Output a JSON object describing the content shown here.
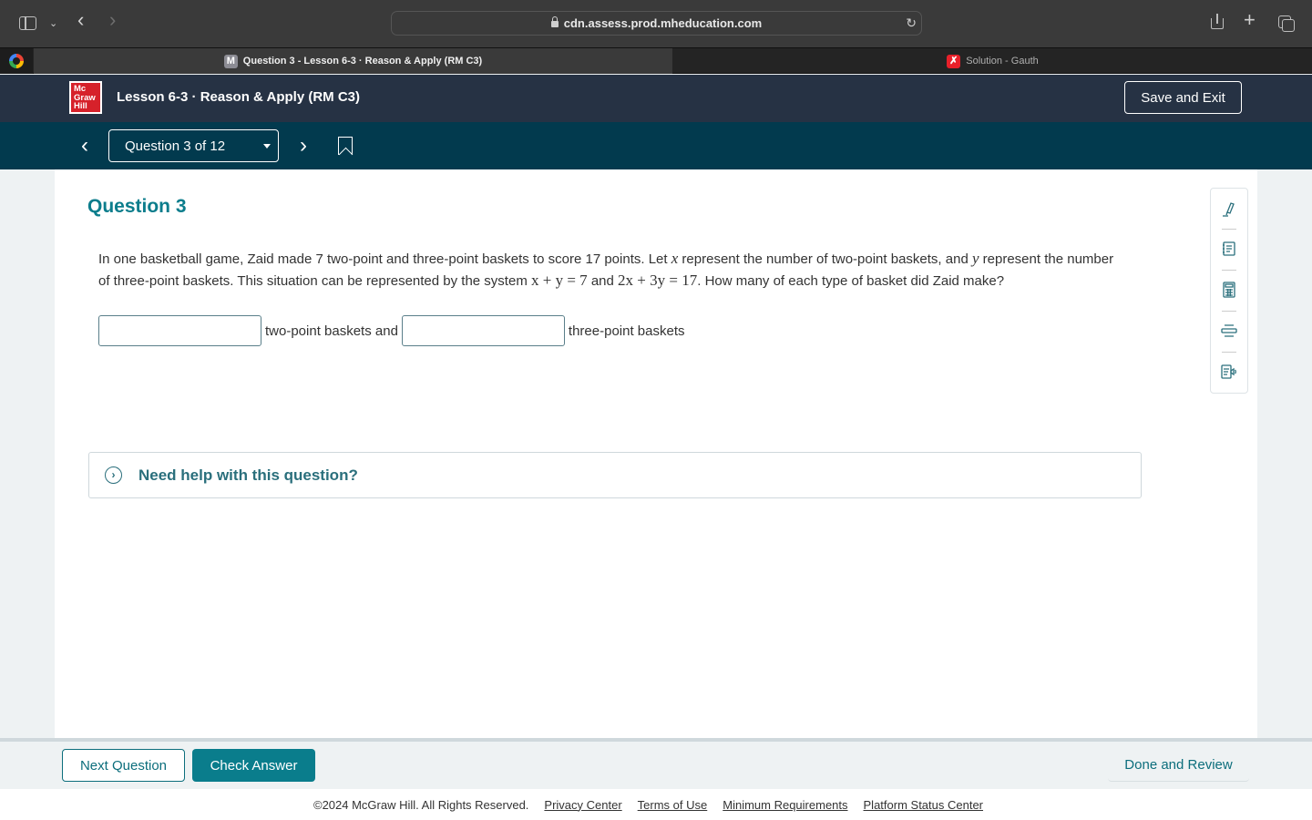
{
  "browser": {
    "url": "cdn.assess.prod.mheducation.com",
    "tabs": [
      {
        "label": "Question 3 - Lesson 6-3 · Reason & Apply (RM C3)",
        "favicon": "M",
        "active": true
      },
      {
        "label": "Solution - Gauth",
        "favicon": "gauth-icon",
        "active": false
      }
    ]
  },
  "header": {
    "logo_lines": [
      "Mc",
      "Graw",
      "Hill"
    ],
    "lesson_title": "Lesson 6-3 · Reason & Apply (RM C3)",
    "save_exit_label": "Save and Exit"
  },
  "nav": {
    "question_selector": "Question 3 of 12"
  },
  "question": {
    "heading": "Question 3",
    "text_parts": {
      "p1": "In one basketball game, Zaid made 7 two-point and three-point baskets to score 17 points. Let ",
      "var_x": "x",
      "p2": " represent the number of two-point baskets, and ",
      "var_y": "y",
      "p3": " represent the number of three-point baskets. This situation can be represented by the system ",
      "eq1": "x + y = 7",
      "p4": " and ",
      "eq2": "2x + 3y = 17",
      "p5": ". How many of each type of basket did Zaid make?"
    },
    "answer": {
      "input1_value": "",
      "label1": "two-point baskets and",
      "input2_value": "",
      "label2": "three-point baskets"
    },
    "help_label": "Need help with this question?"
  },
  "tools": [
    "highlighter-icon",
    "notepad-icon",
    "calculator-icon",
    "line-reader-icon",
    "text-to-speech-icon"
  ],
  "actions": {
    "next_question": "Next Question",
    "check_answer": "Check Answer",
    "done_review": "Done and Review"
  },
  "footer": {
    "copyright": "©2024 McGraw Hill. All Rights Reserved.",
    "links": [
      "Privacy Center",
      "Terms of Use",
      "Minimum Requirements",
      "Platform Status Center"
    ]
  },
  "colors": {
    "accent": "#0a7d8c",
    "header_bg": "#263244",
    "nav_bg": "#023a4e",
    "logo_red": "#d6212a"
  }
}
